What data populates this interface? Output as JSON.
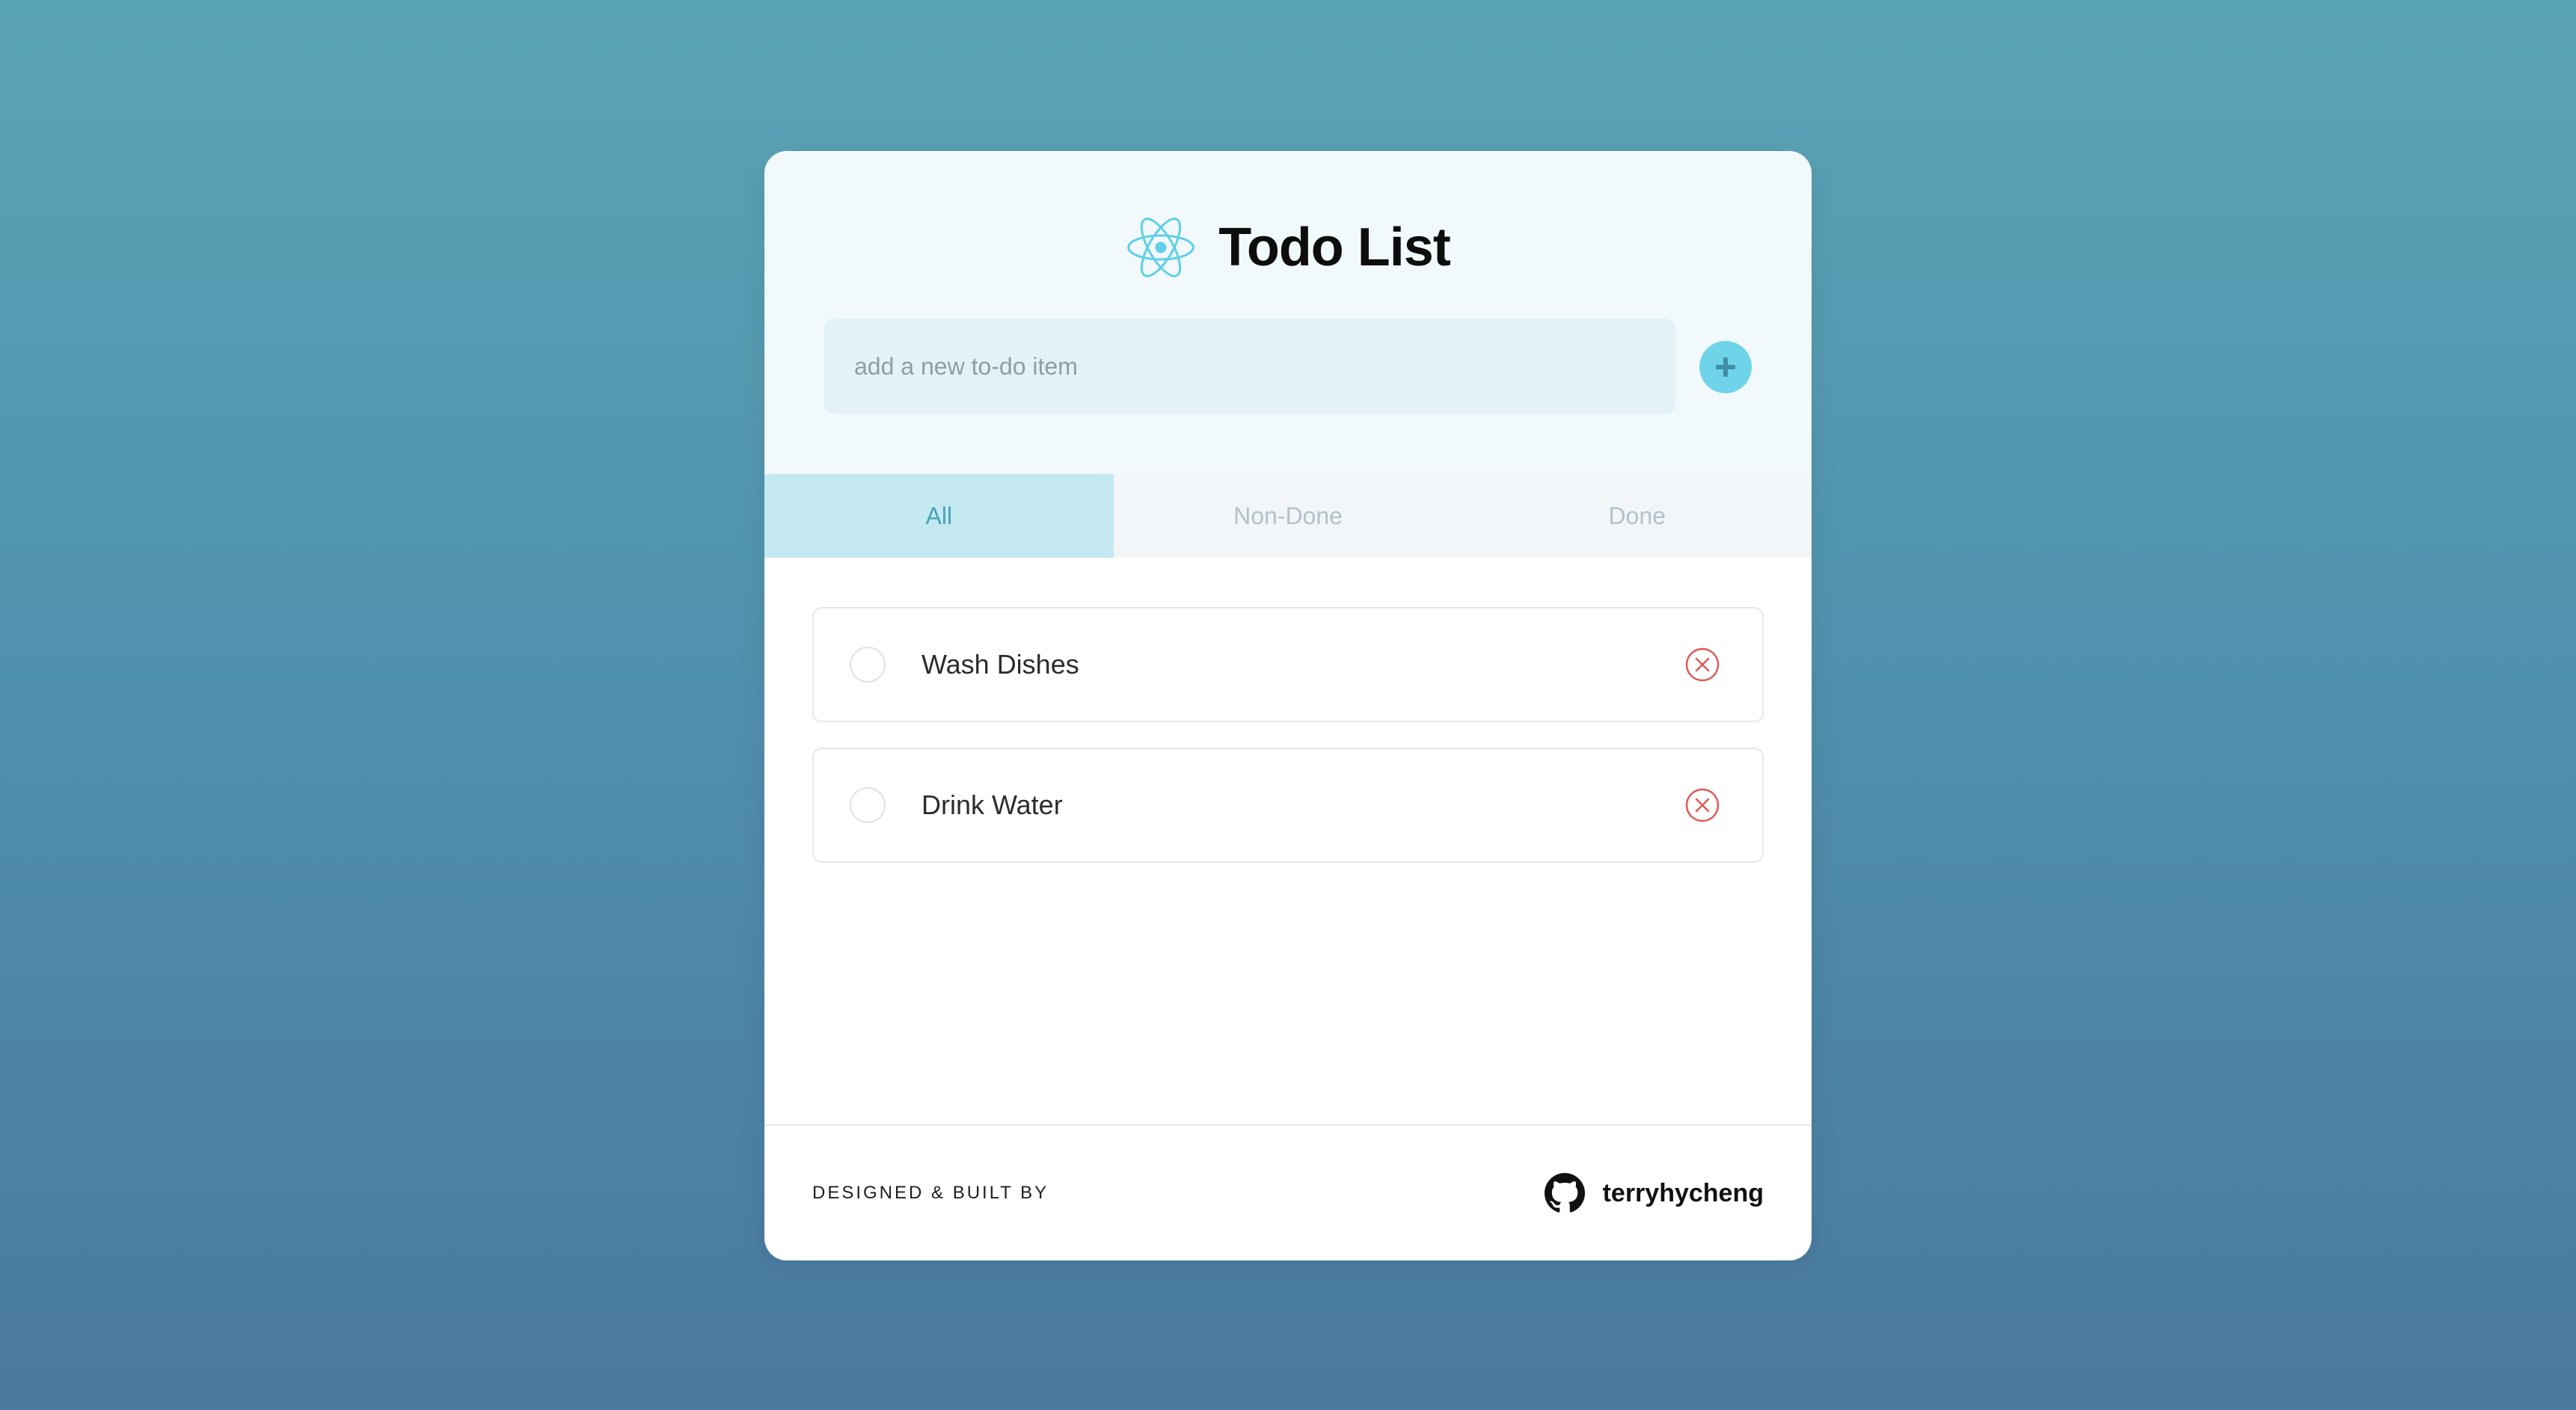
{
  "app": {
    "title": "Todo List",
    "logo_icon": "react-atom-icon",
    "accent": "#6fd3ea",
    "danger": "#e05a5a"
  },
  "new_item": {
    "placeholder": "add a new to-do item",
    "value": "",
    "add_icon": "plus-icon"
  },
  "tabs": [
    {
      "label": "All",
      "active": true
    },
    {
      "label": "Non-Done",
      "active": false
    },
    {
      "label": "Done",
      "active": false
    }
  ],
  "todos": [
    {
      "text": "Wash Dishes",
      "done": false,
      "delete_icon": "close-circle-icon"
    },
    {
      "text": "Drink Water",
      "done": false,
      "delete_icon": "close-circle-icon"
    }
  ],
  "footer": {
    "credit": "DESIGNED & BUILT BY",
    "author": "terryhycheng",
    "author_icon": "github-icon"
  }
}
